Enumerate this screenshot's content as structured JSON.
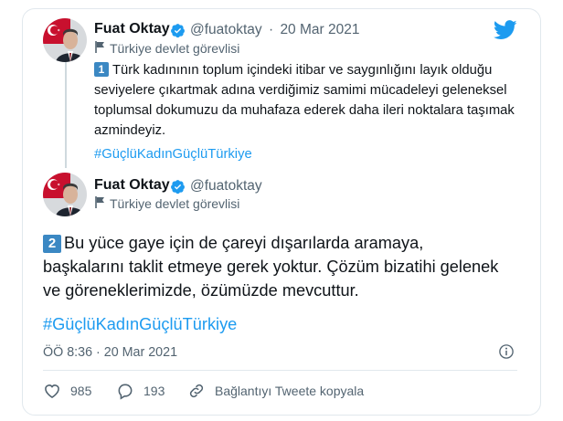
{
  "tweet1": {
    "author_name": "Fuat Oktay",
    "handle": "@fuatoktay",
    "separator": "·",
    "date": "20 Mar 2021",
    "label": "Türkiye devlet görevlisi",
    "number_badge": "1",
    "text": "Türk kadınının toplum içindeki itibar ve saygınlığını layık olduğu seviyelere çıkartmak adına verdiğimiz samimi mücadeleyi geleneksel toplumsal dokumuzu da muhafaza ederek daha ileri noktalara taşımak azmindeyiz.",
    "hashtag": "#GüçlüKadınGüçlüTürkiye"
  },
  "tweet2": {
    "author_name": "Fuat Oktay",
    "handle": "@fuatoktay",
    "label": "Türkiye devlet görevlisi",
    "number_badge": "2",
    "text": "Bu yüce gaye için de çareyi dışarılarda aramaya, başkalarını taklit etmeye gerek yoktur. Çözüm bizatihi gelenek ve göreneklerimizde, özümüzde mevcuttur.",
    "hashtag": "#GüçlüKadınGüçlüTürkiye",
    "timestamp": "ÖÖ 8:36 · 20 Mar 2021"
  },
  "actions": {
    "like_count": "985",
    "reply_count": "193",
    "copy_link_label": "Bağlantıyı Tweete kopyala"
  },
  "colors": {
    "accent": "#1d9bf0",
    "like": "#e0245e",
    "secondary_text": "#536471",
    "badge": "#3b88c3"
  },
  "icons": [
    "twitter-bird-icon",
    "verified-badge-icon",
    "flag-icon",
    "info-icon",
    "heart-icon",
    "reply-icon",
    "link-icon",
    "turkish-flag-icon"
  ]
}
